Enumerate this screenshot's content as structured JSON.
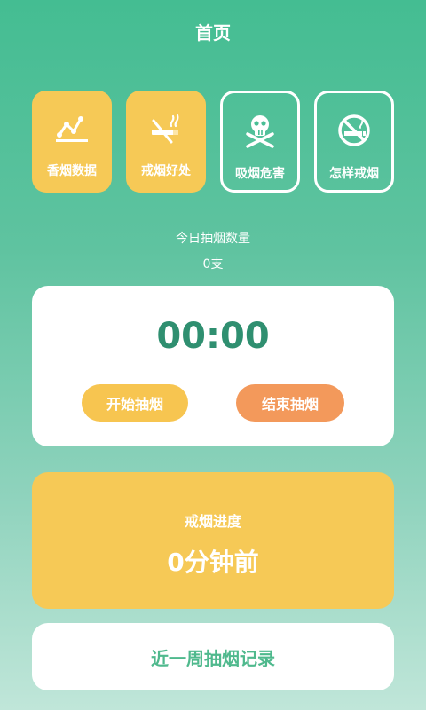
{
  "header": {
    "title": "首页"
  },
  "tiles": [
    {
      "label": "香烟数据",
      "icon": "line-chart-icon",
      "style": "filled"
    },
    {
      "label": "戒烟好处",
      "icon": "no-smoking-cigarette-icon",
      "style": "filled"
    },
    {
      "label": "吸烟危害",
      "icon": "skull-crossbones-icon",
      "style": "outline"
    },
    {
      "label": "怎样戒烟",
      "icon": "no-smoking-circle-icon",
      "style": "outline"
    }
  ],
  "today": {
    "title": "今日抽烟数量",
    "count": "0支"
  },
  "timer": {
    "time": "00:00",
    "start_label": "开始抽烟",
    "end_label": "结束抽烟"
  },
  "progress": {
    "title": "戒烟进度",
    "value": "0分钟前"
  },
  "records": {
    "label": "近一周抽烟记录"
  },
  "colors": {
    "green": "#44bd92",
    "yellow": "#f6c956",
    "orange": "#f3995b",
    "timer_text": "#2f8f70",
    "record_text": "#4fb98d"
  }
}
